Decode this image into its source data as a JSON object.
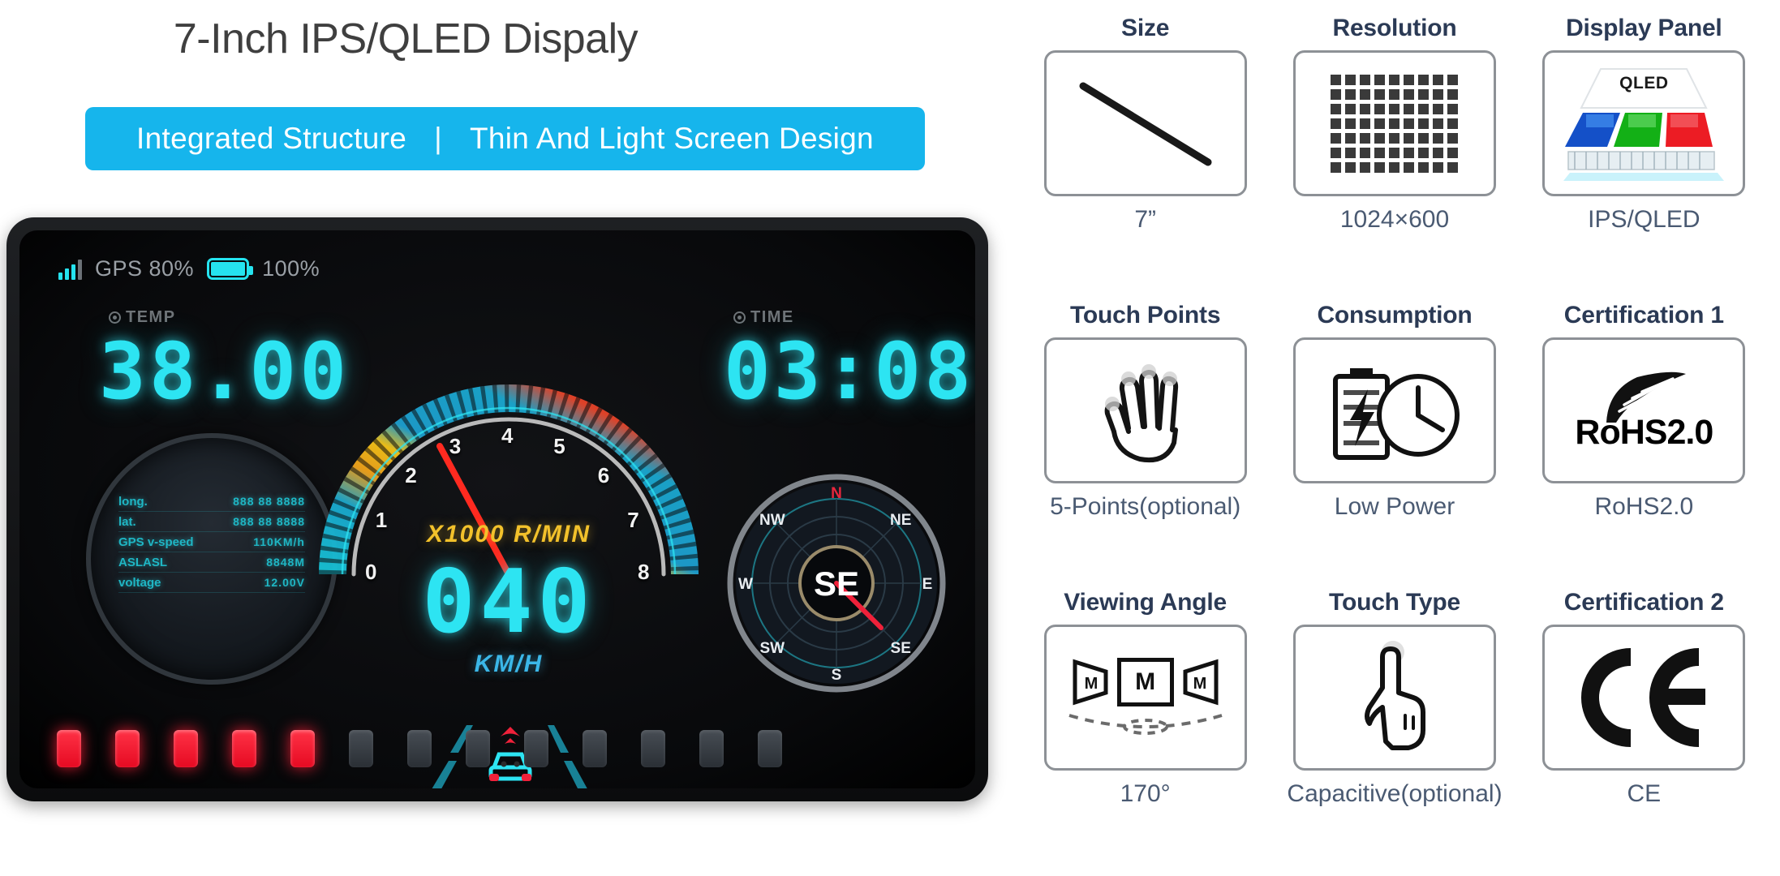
{
  "headline": "7-Inch IPS/QLED Dispaly",
  "banner": {
    "left": "Integrated Structure",
    "sep": "|",
    "right": "Thin And Light Screen Design"
  },
  "colors": {
    "accent": "#16b5ec",
    "cyan_led": "#2de4f2",
    "red_led": "#ff3246",
    "yellow": "#f2c12b",
    "title_ink": "#2b3a55"
  },
  "dashboard": {
    "status": {
      "gps_label": "GPS 80%",
      "battery_label": "100%",
      "signal_icon": "signal-bars-icon",
      "battery_icon": "battery-icon"
    },
    "temp": {
      "label": "TEMP",
      "value": "38.00"
    },
    "time": {
      "label": "TIME",
      "value": "03:08"
    },
    "gps_panel": {
      "rows": [
        {
          "key": "long.",
          "value": "888 88 8888"
        },
        {
          "key": "lat.",
          "value": "888 88 8888"
        },
        {
          "key": "GPS v-speed",
          "value": "110KM/h"
        },
        {
          "key": "ASLASL",
          "value": "8848M"
        },
        {
          "key": "voltage",
          "value": "12.00V"
        }
      ]
    },
    "tach": {
      "unit_label": "X1000 R/MIN",
      "ticks": [
        "0",
        "1",
        "2",
        "3",
        "4",
        "5",
        "6",
        "7",
        "8"
      ],
      "needle_value": 2.5
    },
    "speed": {
      "value": "040",
      "unit": "KM/H"
    },
    "compass": {
      "center": "SE",
      "cardinals": [
        "N",
        "NE",
        "E",
        "SE",
        "S",
        "SW",
        "W",
        "NW"
      ],
      "north_color": "#e8263c",
      "needle_direction": "SE"
    },
    "indicators": {
      "total": 13,
      "active": 5
    }
  },
  "specs": [
    {
      "title": "Size",
      "value": "7”",
      "icon": "diagonal-line-icon"
    },
    {
      "title": "Resolution",
      "value": "1024×600",
      "icon": "pixel-grid-icon"
    },
    {
      "title": "Display Panel",
      "value": "IPS/QLED",
      "icon": "qled-layers-icon",
      "icon_text": "QLED"
    },
    {
      "title": "Touch Points",
      "value": "5-Points(optional)",
      "icon": "open-hand-icon"
    },
    {
      "title": "Consumption",
      "value": "Low Power",
      "icon": "battery-clock-icon"
    },
    {
      "title": "Certification 1",
      "value": "RoHS2.0",
      "icon": "rohs-leaf-icon",
      "icon_text": "RoHS2.0"
    },
    {
      "title": "Viewing Angle",
      "value": "170°",
      "icon": "viewing-angle-icon",
      "icon_text": "M"
    },
    {
      "title": "Touch Type",
      "value": "Capacitive(optional)",
      "icon": "pointing-finger-icon"
    },
    {
      "title": "Certification 2",
      "value": "CE",
      "icon": "ce-mark-icon",
      "icon_text": "CE"
    }
  ]
}
